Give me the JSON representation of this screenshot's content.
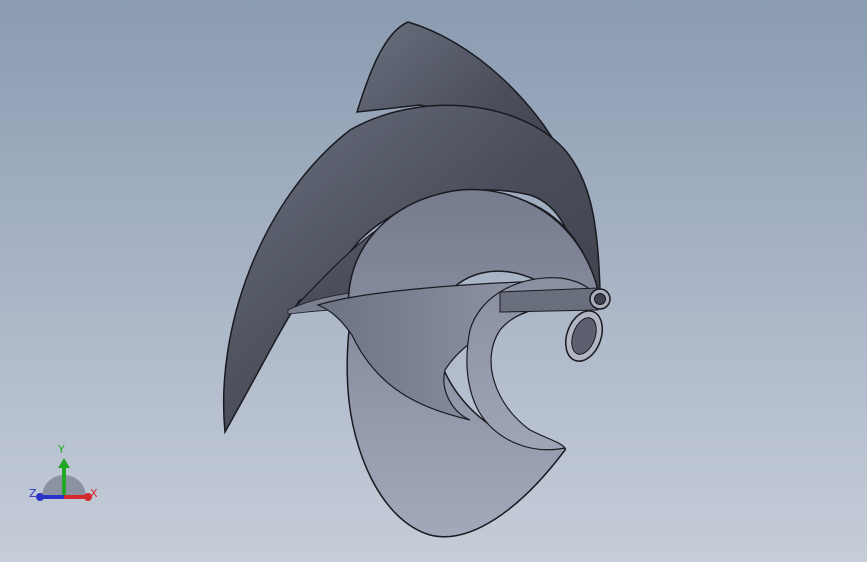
{
  "viewport": {
    "background_top": "#8a9bb0",
    "background_bottom": "#c6cdd9"
  },
  "model": {
    "name": "spiral-turbine-blade",
    "face_color": "#8a8f9e",
    "shadow_color": "#3c3f48",
    "edge_color": "#1a1b20"
  },
  "triad": {
    "x_label": "X",
    "y_label": "Y",
    "z_label": "Z",
    "x_color": "#d22a2a",
    "y_color": "#23a823",
    "z_color": "#2a35c8"
  }
}
